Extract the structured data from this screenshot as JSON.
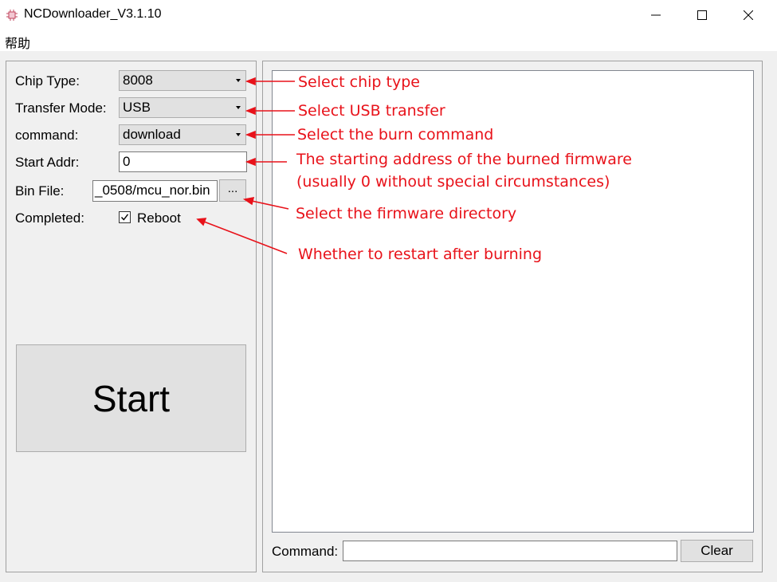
{
  "window": {
    "title": "NCDownloader_V3.1.10"
  },
  "menu": {
    "help_label": "帮助"
  },
  "form": {
    "chip_type_label": "Chip Type:",
    "chip_type_value": "8008",
    "transfer_mode_label": "Transfer Mode:",
    "transfer_mode_value": "USB",
    "command_label": "command:",
    "command_value": "download",
    "start_addr_label": "Start Addr:",
    "start_addr_value": "0",
    "bin_file_label": "Bin File:",
    "bin_file_value": "_0508/mcu_nor.bin",
    "browse_label": "...",
    "completed_label": "Completed:",
    "reboot_label": "Reboot",
    "reboot_checked": true,
    "start_label": "Start"
  },
  "console": {
    "command_label": "Command:",
    "command_value": "",
    "clear_label": "Clear"
  },
  "annotations": {
    "color": "#e8121a",
    "chip": "Select chip type",
    "transfer": "Select USB transfer",
    "command": "Select the burn command",
    "addr_line1": "The starting address of the burned firmware",
    "addr_line2": "(usually 0 without special circumstances)",
    "firmware": "Select the firmware directory",
    "restart": "Whether to restart after burning"
  }
}
